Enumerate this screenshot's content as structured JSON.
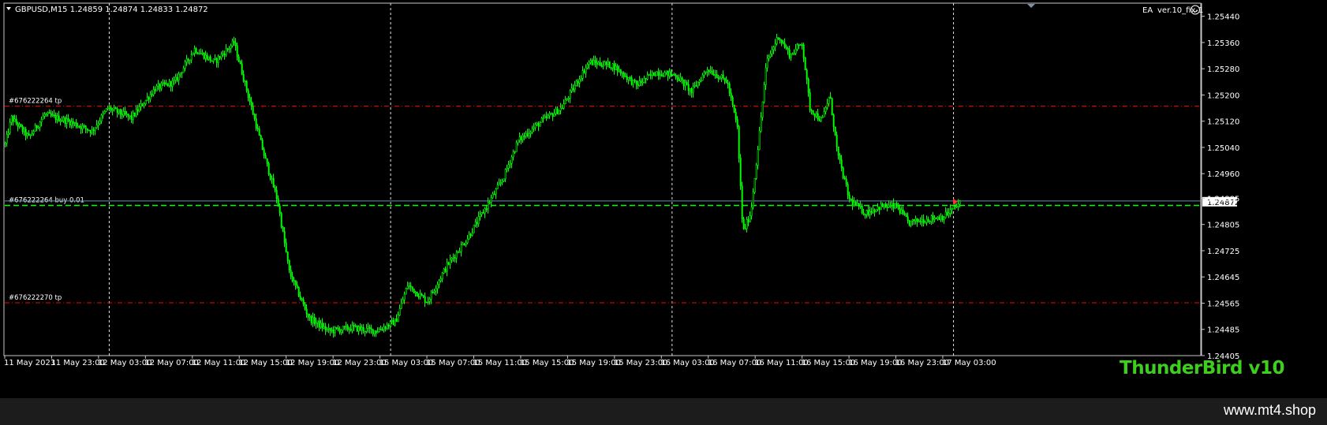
{
  "header": {
    "symbol_info": "GBPUSD,M15  1.24859 1.24874 1.24833 1.24872",
    "ea_label": "EA",
    "ea_version": "ver.10_fix-1"
  },
  "watermark": {
    "text": "ThunderBird v10",
    "color": "#3ecf1e"
  },
  "footer": {
    "text": "www.mt4.shop"
  },
  "colors": {
    "background": "#000000",
    "candle": "#00ff00",
    "tp_line": "#ff0000",
    "entry_line": "#00ff00",
    "current_price_line": "#6a8fb5",
    "text": "#ffffff"
  },
  "order_lines": [
    {
      "label": "#676222264 tp",
      "price": 1.25166,
      "kind": "tp"
    },
    {
      "label": "#676222270 tp",
      "price": 1.24566,
      "kind": "tp"
    },
    {
      "label": "#676222264 buy 0.01",
      "price": 1.24863,
      "kind": "entry"
    }
  ],
  "chart_data": {
    "type": "candlestick",
    "symbol": "GBPUSD",
    "timeframe": "M15",
    "ylim": [
      1.24405,
      1.2548
    ],
    "current_price": 1.24872,
    "y_ticks": [
      1.2544,
      1.2536,
      1.2528,
      1.252,
      1.2512,
      1.2504,
      1.2496,
      1.24885,
      1.24805,
      1.24725,
      1.24645,
      1.24565,
      1.24485,
      1.24405
    ],
    "x_ticks": [
      "11 May 2023",
      "11 May 23:00",
      "12 May 03:00",
      "12 May 07:00",
      "12 May 11:00",
      "12 May 15:00",
      "12 May 19:00",
      "12 May 23:00",
      "15 May 03:00",
      "15 May 07:00",
      "15 May 11:00",
      "15 May 15:00",
      "15 May 19:00",
      "15 May 23:00",
      "16 May 03:00",
      "16 May 07:00",
      "16 May 11:00",
      "16 May 15:00",
      "16 May 19:00",
      "16 May 23:00",
      "17 May 03:00"
    ],
    "grid": "dashed vertical lines",
    "price_path": [
      {
        "x": 0,
        "y": 1.2505
      },
      {
        "x": 8,
        "y": 1.2513
      },
      {
        "x": 30,
        "y": 1.2507
      },
      {
        "x": 50,
        "y": 1.2514
      },
      {
        "x": 80,
        "y": 1.2512
      },
      {
        "x": 110,
        "y": 1.2509
      },
      {
        "x": 130,
        "y": 1.2516
      },
      {
        "x": 160,
        "y": 1.2513
      },
      {
        "x": 190,
        "y": 1.2522
      },
      {
        "x": 215,
        "y": 1.2524
      },
      {
        "x": 240,
        "y": 1.2534
      },
      {
        "x": 265,
        "y": 1.253
      },
      {
        "x": 290,
        "y": 1.2536
      },
      {
        "x": 310,
        "y": 1.2518
      },
      {
        "x": 330,
        "y": 1.25
      },
      {
        "x": 345,
        "y": 1.2488
      },
      {
        "x": 360,
        "y": 1.2466
      },
      {
        "x": 385,
        "y": 1.2452
      },
      {
        "x": 410,
        "y": 1.2448
      },
      {
        "x": 440,
        "y": 1.2449
      },
      {
        "x": 470,
        "y": 1.2448
      },
      {
        "x": 495,
        "y": 1.2451
      },
      {
        "x": 510,
        "y": 1.2462
      },
      {
        "x": 535,
        "y": 1.2457
      },
      {
        "x": 560,
        "y": 1.2468
      },
      {
        "x": 585,
        "y": 1.2476
      },
      {
        "x": 610,
        "y": 1.2486
      },
      {
        "x": 630,
        "y": 1.2494
      },
      {
        "x": 650,
        "y": 1.2506
      },
      {
        "x": 680,
        "y": 1.2512
      },
      {
        "x": 705,
        "y": 1.2516
      },
      {
        "x": 720,
        "y": 1.2522
      },
      {
        "x": 740,
        "y": 1.253
      },
      {
        "x": 770,
        "y": 1.2529
      },
      {
        "x": 800,
        "y": 1.2523
      },
      {
        "x": 825,
        "y": 1.2527
      },
      {
        "x": 850,
        "y": 1.2526
      },
      {
        "x": 870,
        "y": 1.2521
      },
      {
        "x": 890,
        "y": 1.2528
      },
      {
        "x": 915,
        "y": 1.2524
      },
      {
        "x": 928,
        "y": 1.251
      },
      {
        "x": 935,
        "y": 1.2478
      },
      {
        "x": 945,
        "y": 1.2484
      },
      {
        "x": 955,
        "y": 1.2506
      },
      {
        "x": 965,
        "y": 1.253
      },
      {
        "x": 980,
        "y": 1.2538
      },
      {
        "x": 995,
        "y": 1.2532
      },
      {
        "x": 1010,
        "y": 1.2536
      },
      {
        "x": 1020,
        "y": 1.2516
      },
      {
        "x": 1035,
        "y": 1.2512
      },
      {
        "x": 1045,
        "y": 1.252
      },
      {
        "x": 1055,
        "y": 1.2502
      },
      {
        "x": 1070,
        "y": 1.2488
      },
      {
        "x": 1090,
        "y": 1.2484
      },
      {
        "x": 1110,
        "y": 1.2486
      },
      {
        "x": 1130,
        "y": 1.2486
      },
      {
        "x": 1145,
        "y": 1.2481
      },
      {
        "x": 1165,
        "y": 1.2482
      },
      {
        "x": 1190,
        "y": 1.2483
      },
      {
        "x": 1210,
        "y": 1.2487
      }
    ]
  }
}
